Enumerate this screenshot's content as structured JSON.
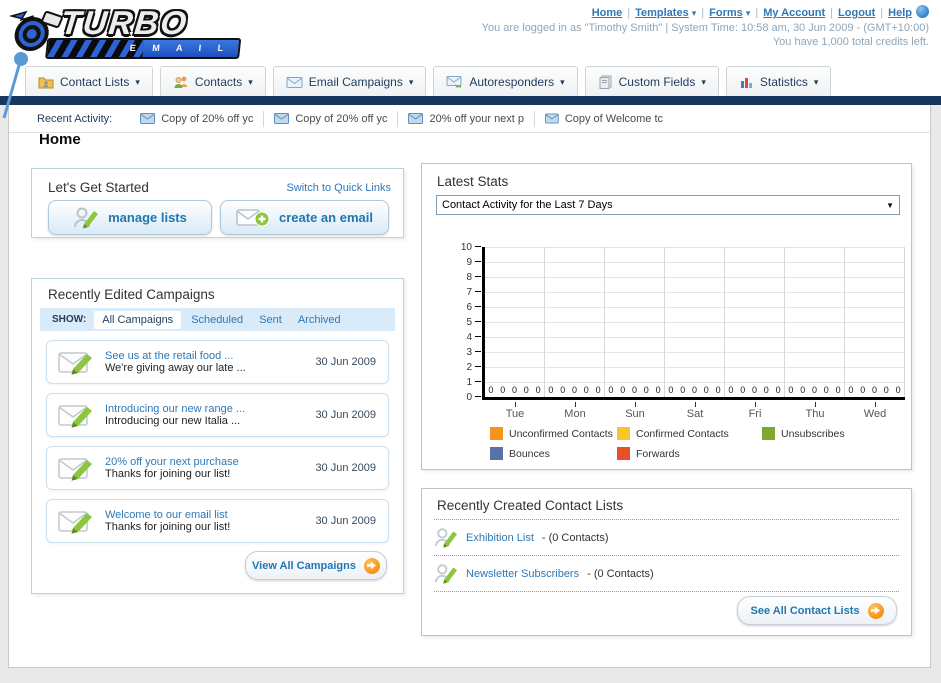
{
  "header": {
    "logo_title": "TURBO",
    "logo_subtitle": "E M A I L",
    "links": [
      "Home",
      "Templates",
      "Forms",
      "My Account",
      "Logout",
      "Help"
    ],
    "links_with_caret": [
      "Templates",
      "Forms"
    ],
    "login_info": "You are logged in as \"Timothy Smith\" | System Time: 10:58 am, 30 Jun 2009 - (GMT+10:00)",
    "credits_info": "You have 1,000 total credits left."
  },
  "nav": {
    "tabs": [
      {
        "label": "Contact Lists"
      },
      {
        "label": "Contacts"
      },
      {
        "label": "Email Campaigns"
      },
      {
        "label": "Autoresponders"
      },
      {
        "label": "Custom Fields"
      },
      {
        "label": "Statistics"
      }
    ]
  },
  "recent_activity": {
    "label": "Recent Activity:",
    "items": [
      "Copy of 20% off yc",
      "Copy of 20% off yc",
      "20% off your next p",
      "Copy of Welcome tc"
    ]
  },
  "page_title": "Home",
  "get_started": {
    "title": "Let's Get Started",
    "switch_link": "Switch to Quick Links",
    "manage_lists_label": "manage lists",
    "create_email_label": "create an email"
  },
  "campaigns": {
    "title": "Recently Edited Campaigns",
    "filter_label": "SHOW:",
    "filters": [
      "All Campaigns",
      "Scheduled",
      "Sent",
      "Archived"
    ],
    "active_filter": "All Campaigns",
    "items": [
      {
        "title": "See us at the retail food ...",
        "subtitle": "We're giving away our late ...",
        "date": "30 Jun 2009"
      },
      {
        "title": "Introducing our new range ...",
        "subtitle": "Introducing our new Italia ...",
        "date": "30 Jun 2009"
      },
      {
        "title": "20% off your next purchase",
        "subtitle": "Thanks for joining our list!",
        "date": "30 Jun 2009"
      },
      {
        "title": "Welcome to our email list",
        "subtitle": "Thanks for joining our list!",
        "date": "30 Jun 2009"
      }
    ],
    "view_all_label": "View All Campaigns"
  },
  "latest_stats": {
    "title": "Latest Stats",
    "dropdown_value": "Contact Activity for the Last 7 Days"
  },
  "chart_data": {
    "type": "bar",
    "title": "Contact Activity for the Last 7 Days",
    "categories": [
      "Tue",
      "Mon",
      "Sun",
      "Sat",
      "Fri",
      "Thu",
      "Wed"
    ],
    "series": [
      {
        "name": "Unconfirmed Contacts",
        "color": "#F7941D",
        "values": [
          0,
          0,
          0,
          0,
          0,
          0,
          0
        ]
      },
      {
        "name": "Confirmed Contacts",
        "color": "#FCC42B",
        "values": [
          0,
          0,
          0,
          0,
          0,
          0,
          0
        ]
      },
      {
        "name": "Unsubscribes",
        "color": "#7FA832",
        "values": [
          0,
          0,
          0,
          0,
          0,
          0,
          0
        ]
      },
      {
        "name": "Bounces",
        "color": "#5872A7",
        "values": [
          0,
          0,
          0,
          0,
          0,
          0,
          0
        ]
      },
      {
        "name": "Forwards",
        "color": "#E8502A",
        "values": [
          0,
          0,
          0,
          0,
          0,
          0,
          0
        ]
      }
    ],
    "ylim": [
      0,
      10
    ],
    "yticks": [
      0,
      1,
      2,
      3,
      4,
      5,
      6,
      7,
      8,
      9,
      10
    ],
    "grid": true,
    "legend_position": "bottom",
    "xlabel": "",
    "ylabel": ""
  },
  "contact_lists": {
    "title": "Recently Created Contact Lists",
    "items": [
      {
        "name": "Exhibition List",
        "count": "- (0 Contacts)"
      },
      {
        "name": "Newsletter Subscribers",
        "count": "- (0 Contacts)"
      }
    ],
    "see_all_label": "See All Contact Lists"
  },
  "glyphs": {
    "caret": "▾",
    "select_caret": "▼",
    "pipe": "|"
  },
  "colors": {
    "navy_bar": "#17375C",
    "link_blue": "#2E79B8",
    "button_text": "#2077B2",
    "arrow_ball": "#F7941D"
  }
}
